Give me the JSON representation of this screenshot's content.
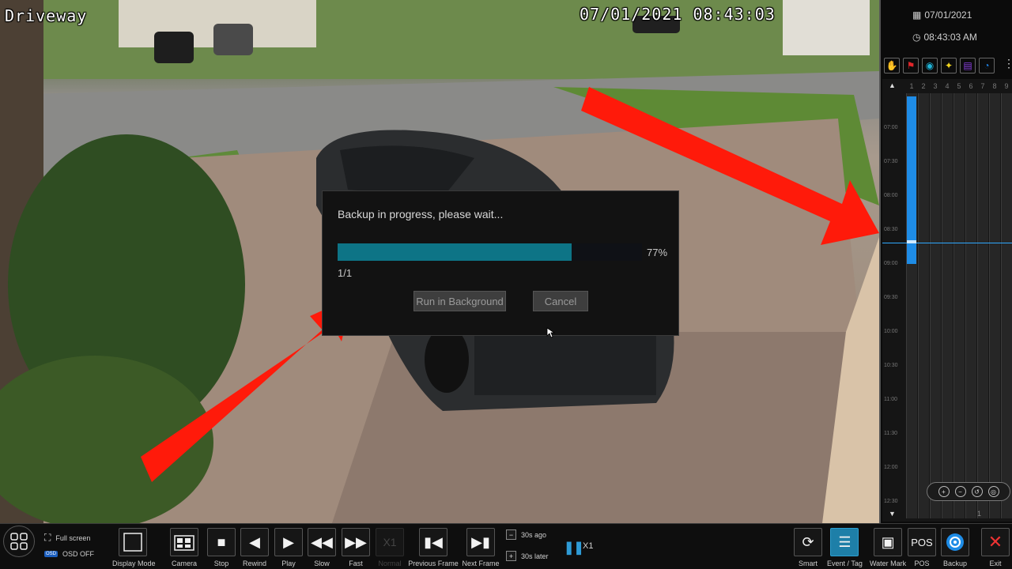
{
  "camera": {
    "name": "Driveway",
    "timestamp": "07/01/2021 08:43:03"
  },
  "dialog": {
    "message": "Backup in progress, please wait...",
    "progress": 0.77,
    "progress_label": "77%",
    "count": "1/1",
    "run_background_label": "Run in Background",
    "cancel_label": "Cancel"
  },
  "panel": {
    "date": "07/01/2021",
    "time": "08:43:03 AM",
    "event_filters": [
      {
        "icon": "motion-icon",
        "color": "#1fbf3a"
      },
      {
        "icon": "alarm-icon",
        "color": "#e0262a"
      },
      {
        "icon": "intelligent-icon",
        "color": "#1fb4d8"
      },
      {
        "icon": "human-icon",
        "color": "#f2d61e"
      },
      {
        "icon": "pos-icon",
        "color": "#8a3fe0"
      },
      {
        "icon": "schedule-icon",
        "color": "#1f7fe0"
      }
    ],
    "channels": [
      "1",
      "2",
      "3",
      "4",
      "5",
      "6",
      "7",
      "8",
      "9"
    ],
    "times": [
      "07:00",
      "07:30",
      "08:00",
      "08:30",
      "09:00",
      "09:30",
      "10:00",
      "10:30",
      "11:00",
      "11:30",
      "12:00",
      "12:30"
    ],
    "page_number": "1"
  },
  "toolbar": {
    "display_mode": "Display Mode",
    "camera": "Camera",
    "full_screen": "Full screen",
    "osd_tag": "OSD",
    "osd_off": "OSD OFF",
    "stop": "Stop",
    "rewind": "Rewind",
    "play": "Play",
    "slow": "Slow",
    "fast": "Fast",
    "normal_badge": "X1",
    "normal": "Normal",
    "previous_frame": "Previous Frame",
    "next_frame": "Next Frame",
    "seek_back": "30s ago",
    "seek_forward": "30s later",
    "speed": "X1",
    "smart": "Smart",
    "event_tag": "Event / Tag",
    "water_mark": "Water Mark",
    "pos_badge": "POS",
    "pos": "POS",
    "backup": "Backup",
    "exit": "Exit"
  }
}
